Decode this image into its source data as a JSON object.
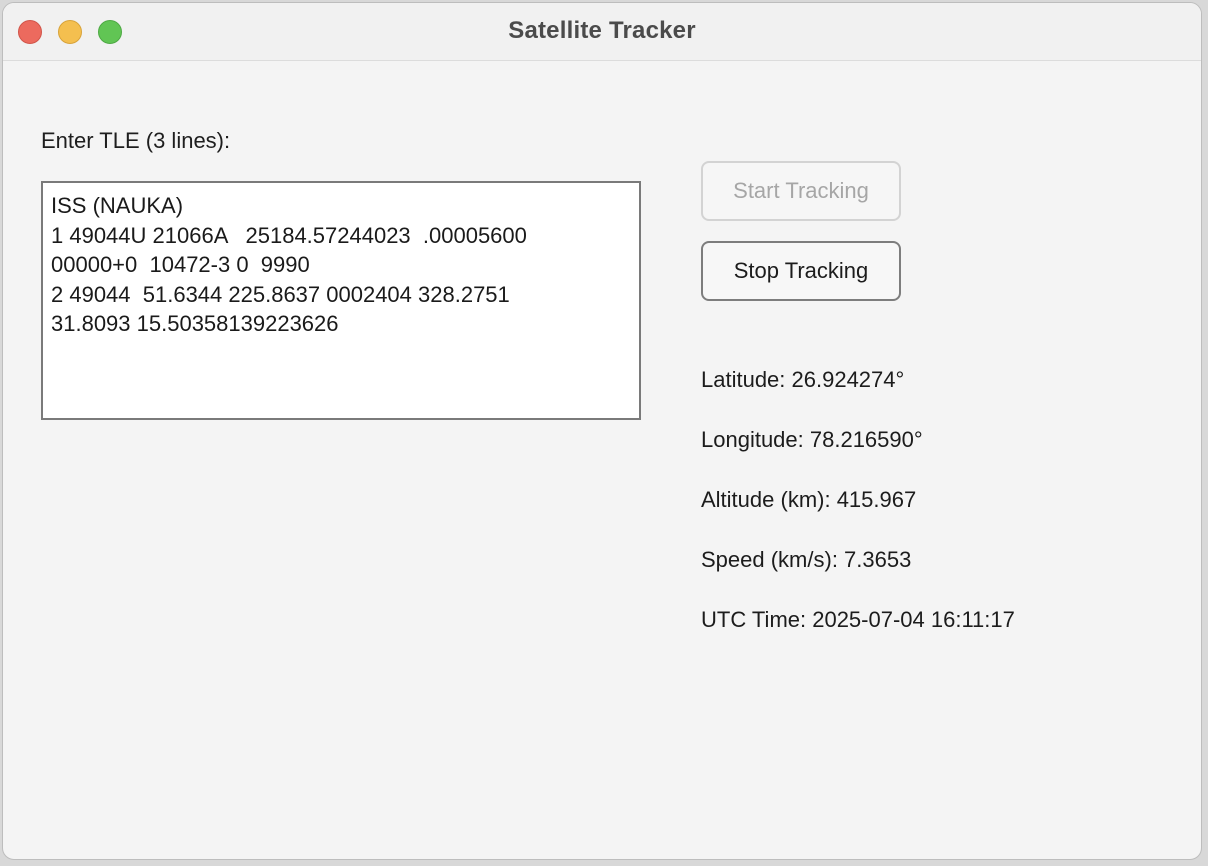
{
  "window": {
    "title": "Satellite Tracker"
  },
  "tle": {
    "label": "Enter TLE (3 lines):",
    "value": "ISS (NAUKA)\n1 49044U 21066A   25184.57244023  .00005600\n00000+0  10472-3 0  9990\n2 49044  51.6344 225.8637 0002404 328.2751\n31.8093 15.50358139223626"
  },
  "controls": {
    "start_label": "Start Tracking",
    "start_enabled": false,
    "stop_label": "Stop Tracking",
    "stop_enabled": true
  },
  "readouts": {
    "latitude": "Latitude: 26.924274°",
    "longitude": "Longitude: 78.216590°",
    "altitude": "Altitude (km): 415.967",
    "speed": "Speed (km/s): 7.3653",
    "utc_time": "UTC Time: 2025-07-04 16:11:17"
  },
  "colors": {
    "close": "#ec6a5e",
    "minimize": "#f4bf4f",
    "maximize": "#61c554",
    "window_bg": "#f4f4f4"
  }
}
